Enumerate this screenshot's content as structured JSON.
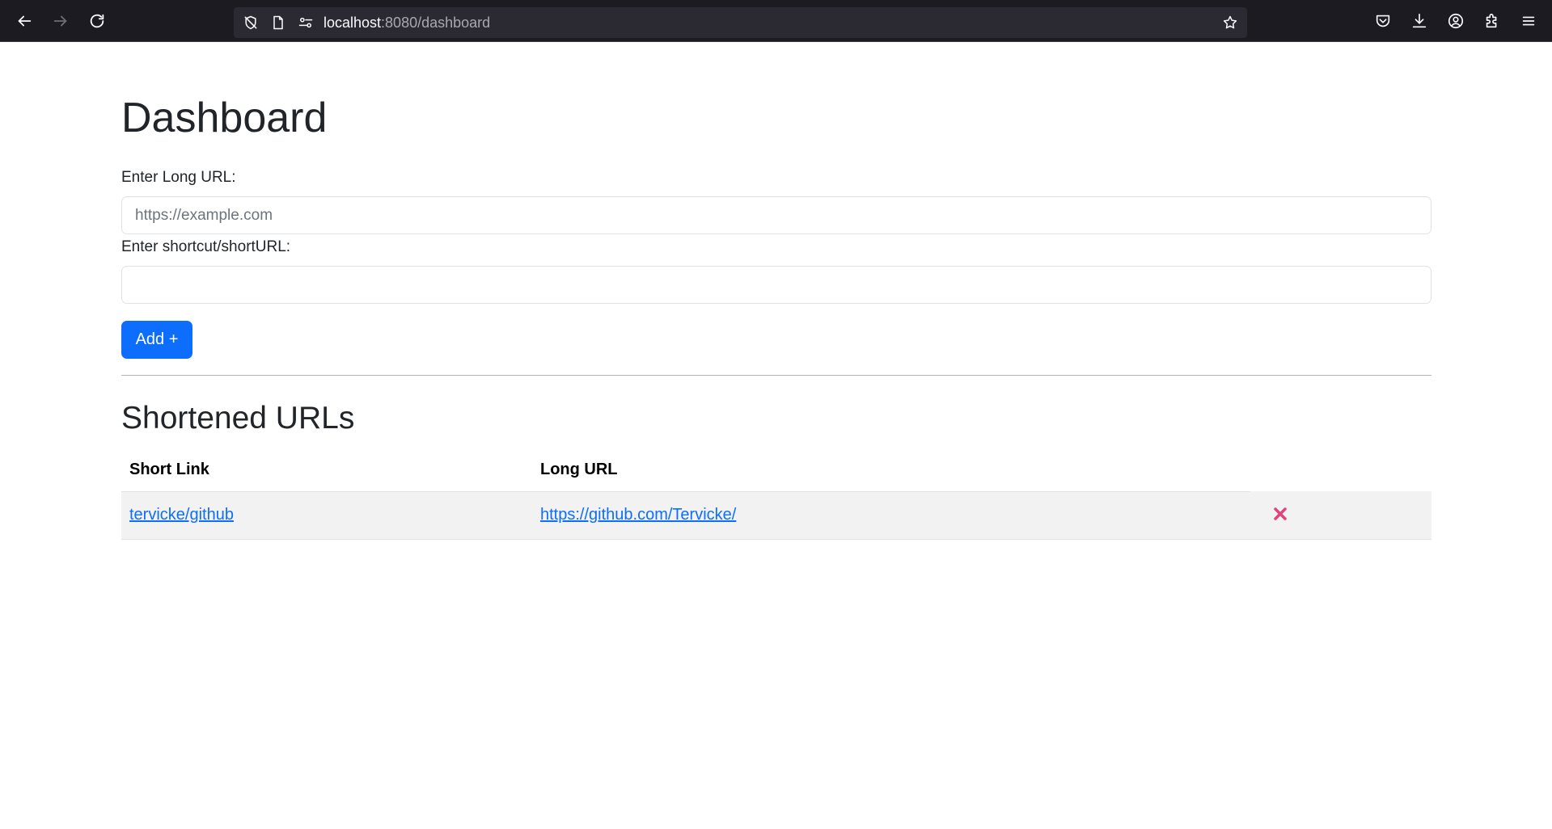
{
  "browser": {
    "url_host": "localhost",
    "url_rest": ":8080/dashboard"
  },
  "page": {
    "title": "Dashboard",
    "long_url_label": "Enter Long URL:",
    "long_url_placeholder": "https://example.com",
    "long_url_value": "",
    "short_url_label": "Enter shortcut/shortURL:",
    "short_url_value": "",
    "add_button": "Add +",
    "list_title": "Shortened URLs"
  },
  "table": {
    "headers": [
      "Short Link",
      "Long URL"
    ],
    "rows": [
      {
        "short": "tervicke/github",
        "long": "https://github.com/Tervicke/"
      }
    ]
  },
  "colors": {
    "accent": "#0d6efd",
    "delete": "#e0447c",
    "chrome": "#1c1b22"
  }
}
